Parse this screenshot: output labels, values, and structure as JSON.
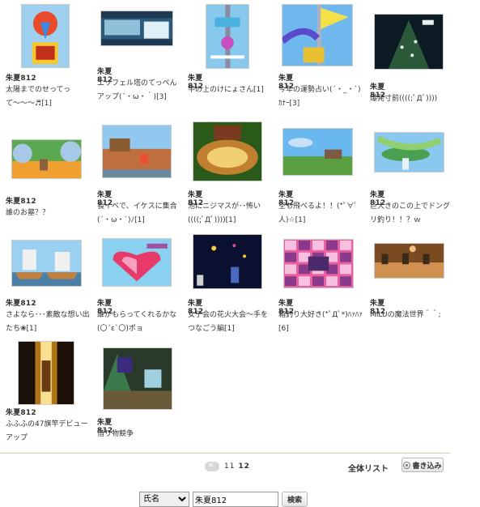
{
  "posts": [
    {
      "author": "朱夏812",
      "title": "太陽までのせってって〜〜〜♬",
      "count": "[1]",
      "palette": [
        "#9fd0f0",
        "#e84a2a",
        "#3a8ae0",
        "#f6c830"
      ],
      "scene": "balloon"
    },
    {
      "author": "朱夏812",
      "title": "エッフェル塔のてっぺんアップ(´・ω・｀)",
      "count": "[3]",
      "palette": [
        "#2d5a7a",
        "#8fc1d8",
        "#1e3a52",
        "#e0f0f8"
      ],
      "scene": "ui"
    },
    {
      "author": "朱夏812",
      "title": "竿の上のけにょさん",
      "count": "[1]",
      "palette": [
        "#87c8ec",
        "#4ab0e0",
        "#c84ec0",
        "#ffffff"
      ],
      "scene": "pole"
    },
    {
      "author": "朱夏812",
      "title": "今年の運勢占い(´・_・`)ｶﾅｰ",
      "count": "[3]",
      "palette": [
        "#6fb8ee",
        "#f6e04a",
        "#5a4acc",
        "#c8e4f8"
      ],
      "scene": "flag"
    },
    {
      "author": "朱夏812",
      "title": "爆発寸前((((;ﾟДﾟ))))",
      "count": "",
      "palette": [
        "#0c1a24",
        "#2a5a3a",
        "#e8f0f0",
        "#1a2e38"
      ],
      "scene": "tree"
    },
    {
      "author": "朱夏812",
      "title": "誰のお墓？？",
      "count": "",
      "palette": [
        "#5aa850",
        "#f0a030",
        "#a8c8e8",
        "#8a6040"
      ],
      "scene": "field"
    },
    {
      "author": "朱夏812",
      "title": "長イベで、イケスに集合(´・ω・`)ﾉ",
      "count": "[1]",
      "palette": [
        "#90c8f0",
        "#c07040",
        "#8a5a30",
        "#e85030"
      ],
      "scene": "dock"
    },
    {
      "author": "朱夏812",
      "title": "池にニジマスが･･怖い((((;ﾟДﾟ))))",
      "count": "[1]",
      "palette": [
        "#2a5a1a",
        "#c08030",
        "#f0d070",
        "#7a3a20"
      ],
      "scene": "pond"
    },
    {
      "author": "朱夏812",
      "title": "空も飛べるよ！！(*ﾟ∀ﾟ人)☆",
      "count": "[1]",
      "palette": [
        "#6ab8f0",
        "#5aa040",
        "#c8e0f8",
        "#7a5a40"
      ],
      "scene": "sky"
    },
    {
      "author": "朱夏812",
      "title": "巨大きのこの上でドングリ釣り！！？ｗ",
      "count": "",
      "palette": [
        "#8ac8f0",
        "#4aa050",
        "#90d070",
        "#e8f0f8"
      ],
      "scene": "mushroom"
    },
    {
      "author": "朱夏812",
      "title": "さよなら･･･素敵な想い出たち❀",
      "count": "[1]",
      "palette": [
        "#9ad0f0",
        "#c08040",
        "#f0f0f0",
        "#6a4a30"
      ],
      "scene": "ship"
    },
    {
      "author": "朱夏812",
      "title": "誰がもらってくれるかな(〇´ε`〇)ポョ",
      "count": "",
      "palette": [
        "#8ad0f0",
        "#e83a6a",
        "#f8a0c0",
        "#ffffff"
      ],
      "scene": "heart"
    },
    {
      "author": "朱夏812",
      "title": "女子会の花火大会〜手をつなごう編",
      "count": "[1]",
      "palette": [
        "#0a1030",
        "#f0d040",
        "#e04a8a",
        "#4a6ac0"
      ],
      "scene": "night"
    },
    {
      "author": "朱夏812",
      "title": "箱釣り大好き(*ﾟДﾟ*)ﾊｧﾊｧ",
      "count": "[6]",
      "palette": [
        "#e860a0",
        "#8a3a8a",
        "#f8c0e0",
        "#4a2a6a"
      ],
      "scene": "grid"
    },
    {
      "author": "朱夏812",
      "title": "MILUの魔法世界＾＾;",
      "count": "",
      "palette": [
        "#7a4a20",
        "#d09050",
        "#f0c080",
        "#3a2a1a"
      ],
      "scene": "room"
    },
    {
      "author": "朱夏812",
      "title": "ふふふの47旗竿デビューアップ",
      "count": "",
      "palette": [
        "#1a1008",
        "#f0a020",
        "#f8e090",
        "#6a3a10"
      ],
      "scene": "glow"
    },
    {
      "author": "朱夏812",
      "title": "借り物競争",
      "count": "",
      "palette": [
        "#2a3a2a",
        "#3a7a4a",
        "#a0d0e0",
        "#6a5a3a"
      ],
      "scene": "forest"
    }
  ],
  "pager": {
    "pages": "11",
    "current": "12"
  },
  "list_all": "全体リスト",
  "write_label": "書き込み",
  "search": {
    "field": "氏名",
    "value": "朱夏812",
    "button": "検索"
  }
}
